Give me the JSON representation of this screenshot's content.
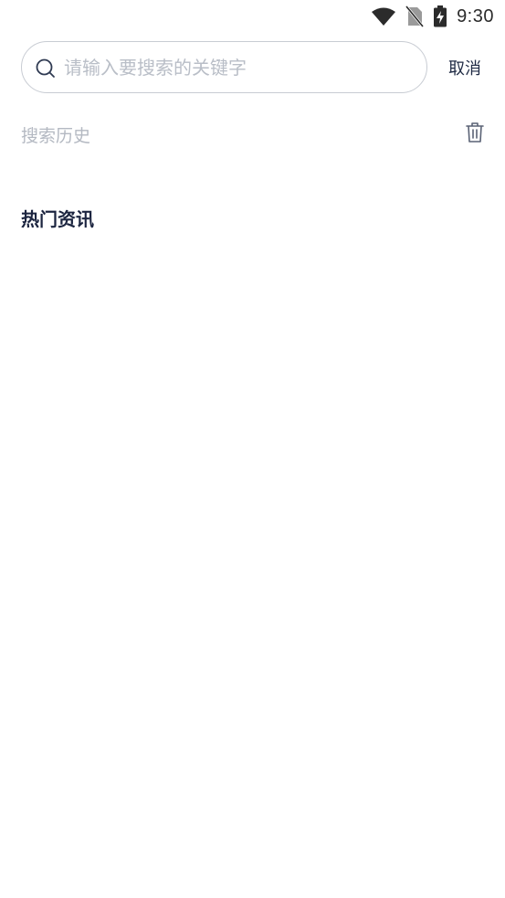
{
  "status_bar": {
    "time": "9:30",
    "icons": [
      "wifi-icon",
      "no-sim-icon",
      "battery-charging-icon"
    ]
  },
  "search": {
    "placeholder": "请输入要搜索的关键字",
    "value": "",
    "cancel_label": "取消",
    "icon": "search-icon"
  },
  "history": {
    "title": "搜索历史",
    "clear_icon": "trash-icon"
  },
  "hot_news": {
    "title": "热门资讯"
  },
  "colors": {
    "text_primary": "#1f2a44",
    "text_muted": "#b4b9c2",
    "border": "#c8ccd3",
    "background": "#ffffff"
  }
}
